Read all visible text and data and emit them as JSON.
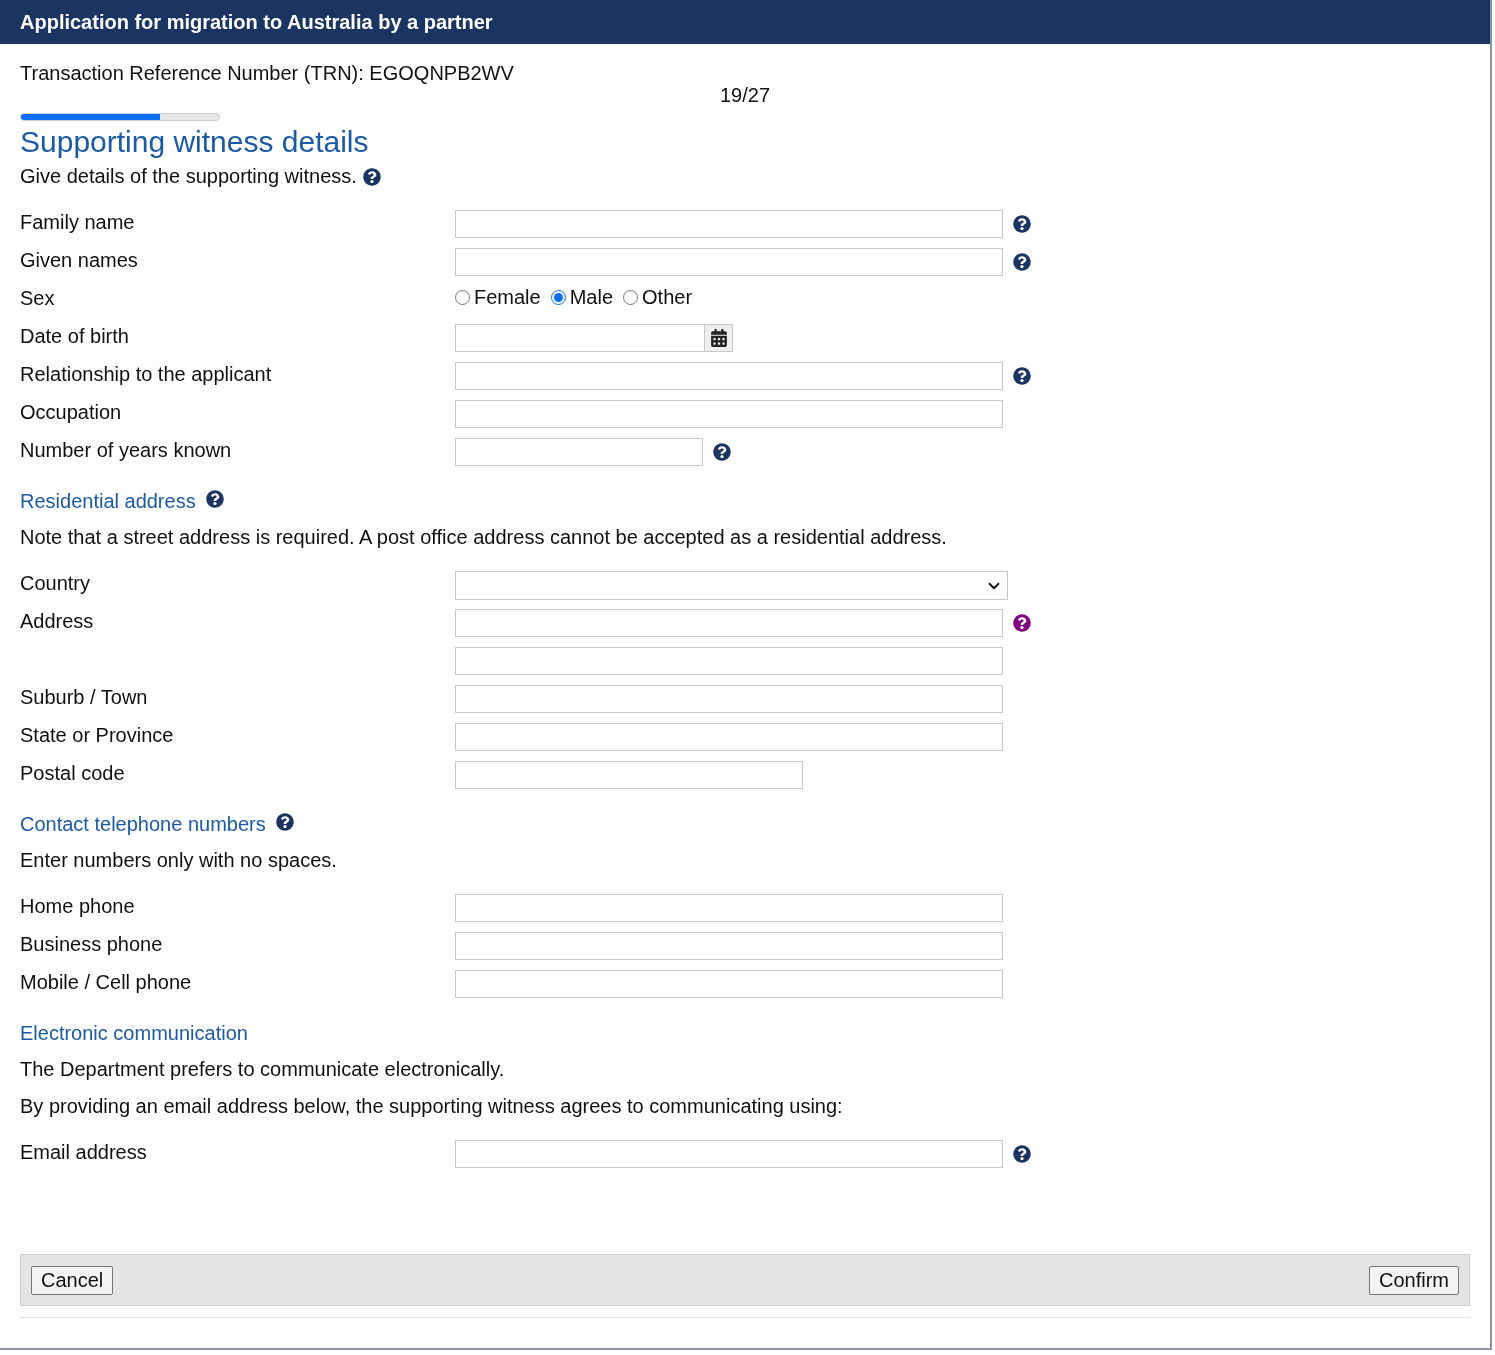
{
  "window": {
    "title": "Application for migration to Australia by a partner"
  },
  "trn": "Transaction Reference Number (TRN): EGOQNPB2WV",
  "step": "19/27",
  "progress": {
    "level": 0.7
  },
  "heading": "Supporting witness details",
  "sections": [
    {
      "notes": [
        {
          "text": "Give details of the supporting witness.",
          "help": true
        }
      ],
      "fields": [
        {
          "kind": "text",
          "label": "Family name",
          "help": true
        },
        {
          "kind": "text",
          "label": "Given names",
          "help": true
        },
        {
          "kind": "radio",
          "label": "Sex",
          "options": [
            {
              "label": "Female",
              "selected": false
            },
            {
              "label": "Male",
              "selected": true
            },
            {
              "label": "Other",
              "selected": false
            }
          ]
        },
        {
          "kind": "date",
          "label": "Date of birth"
        },
        {
          "kind": "text",
          "label": "Relationship to the applicant",
          "help": true
        },
        {
          "kind": "text",
          "label": "Occupation"
        },
        {
          "kind": "shorttext",
          "label": "Number of years known",
          "help": true
        }
      ]
    },
    {
      "title": "Residential address",
      "title_help": true,
      "notes": [
        {
          "text": "Note that a street address is required. A post office address cannot be accepted as a residential address."
        }
      ],
      "fields": [
        {
          "kind": "select",
          "label": "Country"
        },
        {
          "kind": "text",
          "label": "Address",
          "help": true,
          "help_visited": true
        },
        {
          "kind": "text"
        },
        {
          "kind": "text",
          "label": "Suburb / Town"
        },
        {
          "kind": "text",
          "label": "State or Province"
        },
        {
          "kind": "mediumtext",
          "label": "Postal code"
        }
      ]
    },
    {
      "title": "Contact telephone numbers",
      "title_help": true,
      "notes": [
        {
          "text": "Enter numbers only with no spaces."
        }
      ],
      "fields": [
        {
          "kind": "text",
          "label": "Home phone"
        },
        {
          "kind": "text",
          "label": "Business phone"
        },
        {
          "kind": "text",
          "label": "Mobile / Cell phone"
        }
      ]
    },
    {
      "title": "Electronic communication",
      "notes": [
        {
          "text": "The Department prefers to communicate electronically."
        },
        {
          "text": "By providing an email address below, the supporting witness agrees to communicating using:"
        }
      ],
      "fields": [
        {
          "kind": "text",
          "label": "Email address",
          "help": true
        }
      ]
    }
  ],
  "buttons": {
    "cancel": "Cancel",
    "confirm": "Confirm"
  }
}
